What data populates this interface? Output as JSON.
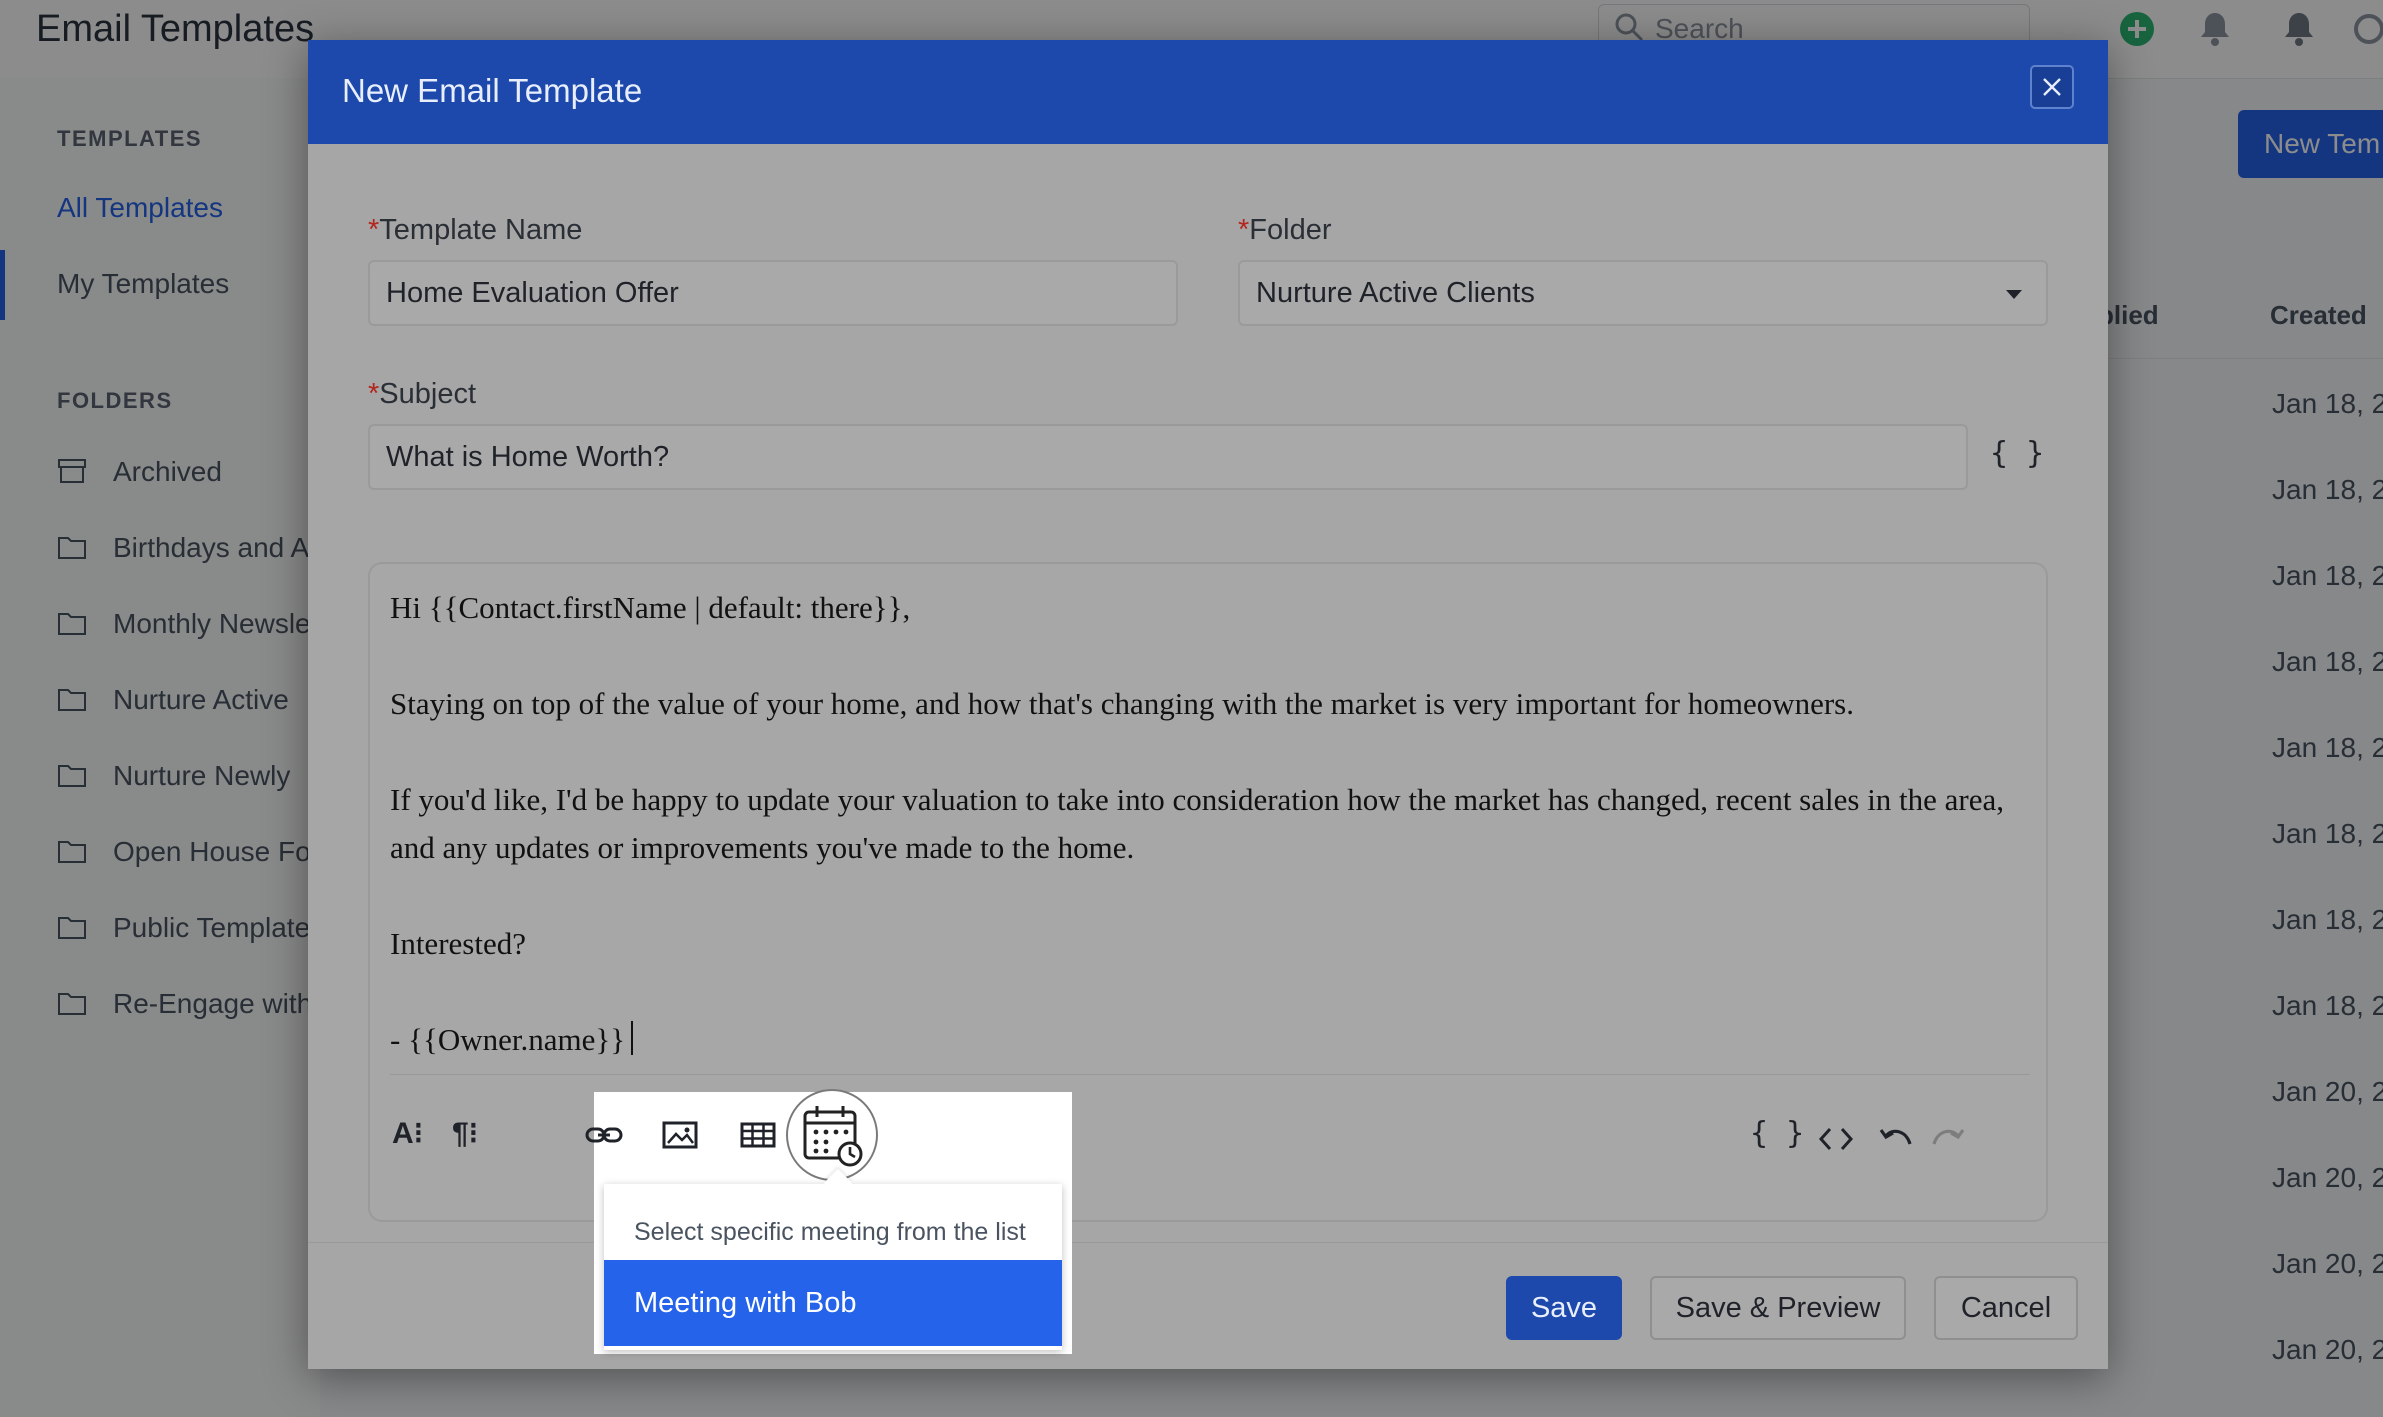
{
  "app": {
    "title": "Email Templates",
    "search_placeholder": "Search",
    "new_template_label": "New Tem"
  },
  "sidebar": {
    "templates_heading": "TEMPLATES",
    "links": [
      {
        "label": "All Templates",
        "active": true
      },
      {
        "label": "My Templates",
        "active": false
      }
    ],
    "folders_heading": "FOLDERS",
    "folders": [
      {
        "label": "Archived",
        "icon": "archive-icon"
      },
      {
        "label": "Birthdays and A",
        "icon": "folder-icon"
      },
      {
        "label": "Monthly Newsle",
        "icon": "folder-icon"
      },
      {
        "label": "Nurture Active",
        "icon": "folder-icon"
      },
      {
        "label": "Nurture Newly",
        "icon": "folder-icon"
      },
      {
        "label": "Open House Fo",
        "icon": "folder-icon"
      },
      {
        "label": "Public Template",
        "icon": "folder-icon"
      },
      {
        "label": "Re-Engage with",
        "icon": "folder-icon"
      }
    ]
  },
  "table": {
    "columns": [
      "plied",
      "Created"
    ],
    "created_dates": [
      "Jan 18, 2",
      "Jan 18, 2",
      "Jan 18, 2",
      "Jan 18, 2",
      "Jan 18, 2",
      "Jan 18, 2",
      "Jan 18, 2",
      "Jan 18, 2",
      "Jan 20, 2",
      "Jan 20, 2",
      "Jan 20, 2",
      "Jan 20, 2"
    ]
  },
  "modal": {
    "title": "New Email Template",
    "template_name": {
      "label": "Template Name",
      "required_mark": "*",
      "value": "Home Evaluation Offer"
    },
    "folder": {
      "label": "Folder",
      "required_mark": "*",
      "value": "Nurture Active Clients"
    },
    "subject": {
      "label": "Subject",
      "required_mark": "*",
      "value": "What is Home Worth?"
    },
    "merge_field_label": "{ }",
    "body": {
      "p1": "Hi {{Contact.firstName | default: there}},",
      "p2": "Staying on top of the value of your home, and how that's changing with the market is very important for homeowners.",
      "p3": "If you'd like, I'd be happy to update your valuation to take into consideration how the market has changed, recent sales in the area, and any updates or improvements you've made to the home.",
      "p4": "Interested?",
      "p5": "- {{Owner.name}}"
    },
    "toolbar_text": {
      "font": "A⁝",
      "paragraph": "¶⁝",
      "merge": "{ }"
    },
    "buttons": {
      "save": "Save",
      "save_preview": "Save & Preview",
      "cancel": "Cancel"
    }
  },
  "meeting_popup": {
    "hint": "Select specific meeting from the list",
    "options": [
      "Meeting with Bob"
    ]
  },
  "colors": {
    "modal_header": "#1c49ab",
    "primary": "#2563eb",
    "required": "#b3261e"
  }
}
